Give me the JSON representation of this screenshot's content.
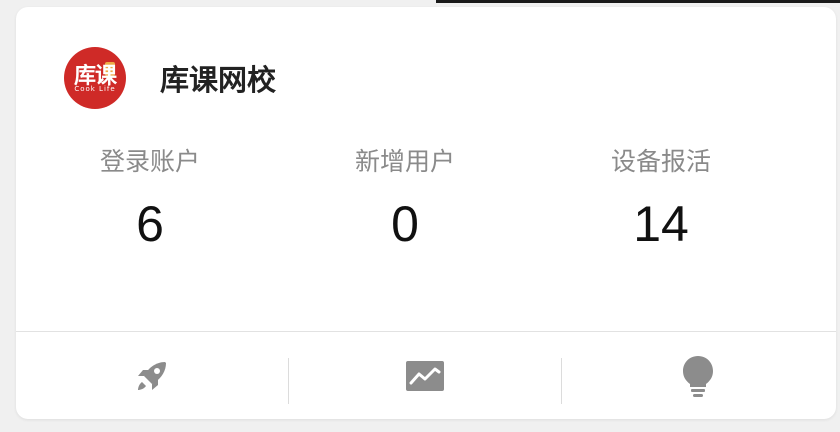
{
  "app": {
    "logo_text": "库课",
    "logo_subtext": "Cook Life",
    "title": "库课网校"
  },
  "stats": [
    {
      "label": "登录账户",
      "value": "6"
    },
    {
      "label": "新增用户",
      "value": "0"
    },
    {
      "label": "设备报活",
      "value": "14"
    }
  ],
  "actions": [
    {
      "icon": "rocket-icon"
    },
    {
      "icon": "trending-chart-icon"
    },
    {
      "icon": "lightbulb-icon"
    }
  ],
  "colors": {
    "brand_red": "#cf2a27",
    "icon_gray": "#8c8c8c",
    "label_gray": "#8a8a8a",
    "value_black": "#111111"
  }
}
